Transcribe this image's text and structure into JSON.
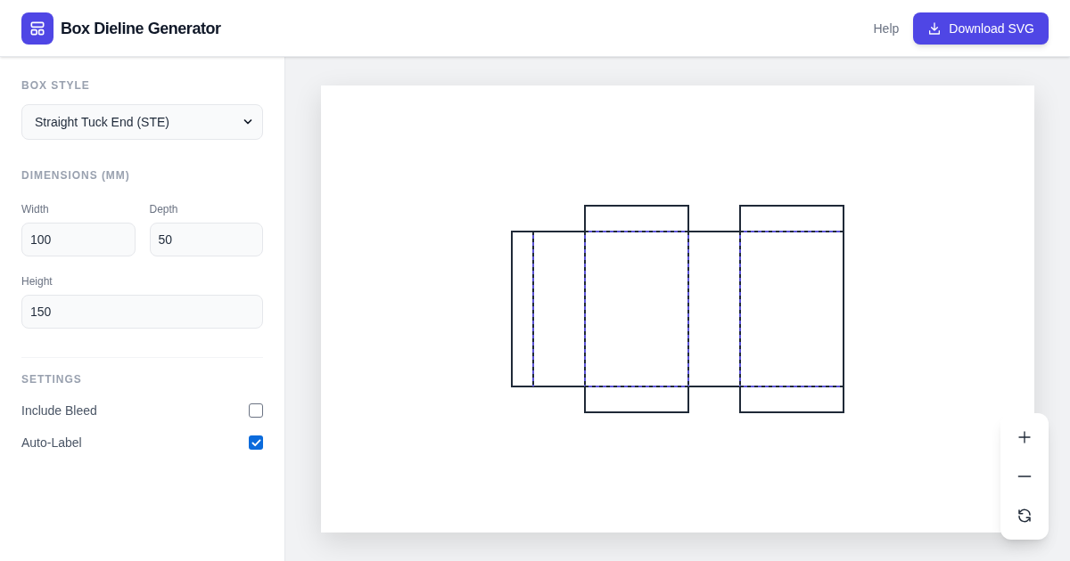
{
  "app": {
    "title": "Box Dieline Generator"
  },
  "header_actions": {
    "help_link": "Help",
    "download_button": "Download SVG"
  },
  "sidebar": {
    "box_style": {
      "heading": "BOX STYLE",
      "value": "Straight Tuck End (STE)"
    },
    "dimensions": {
      "heading": "DIMENSIONS (MM)",
      "fields": [
        {
          "label": "Width",
          "value": "100"
        },
        {
          "label": "Depth",
          "value": "50"
        },
        {
          "label": "Height",
          "value": "150"
        }
      ]
    },
    "settings": {
      "heading": "SETTINGS",
      "items": [
        {
          "label": "Include Bleed",
          "checked": false
        },
        {
          "label": "Auto-Label",
          "checked": true
        }
      ]
    }
  }
}
